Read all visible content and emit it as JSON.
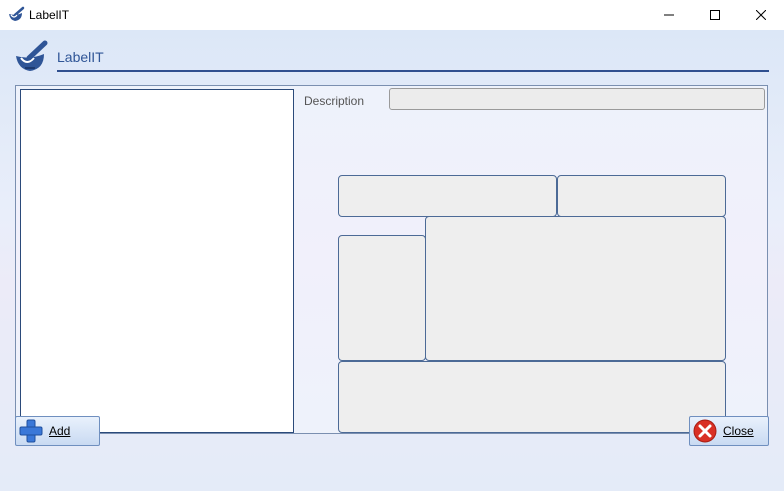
{
  "window": {
    "title": "LabelIT"
  },
  "header": {
    "title": "LabelIT"
  },
  "form": {
    "description_label": "Description",
    "description_value": ""
  },
  "buttons": {
    "add_label": "Add",
    "close_label": "Close"
  },
  "icons": {
    "app": "mortar-pestle-icon",
    "add": "plus-icon",
    "close": "close-circle-icon"
  },
  "colors": {
    "accent": "#2f5597",
    "frame": "#2b4a7a"
  }
}
